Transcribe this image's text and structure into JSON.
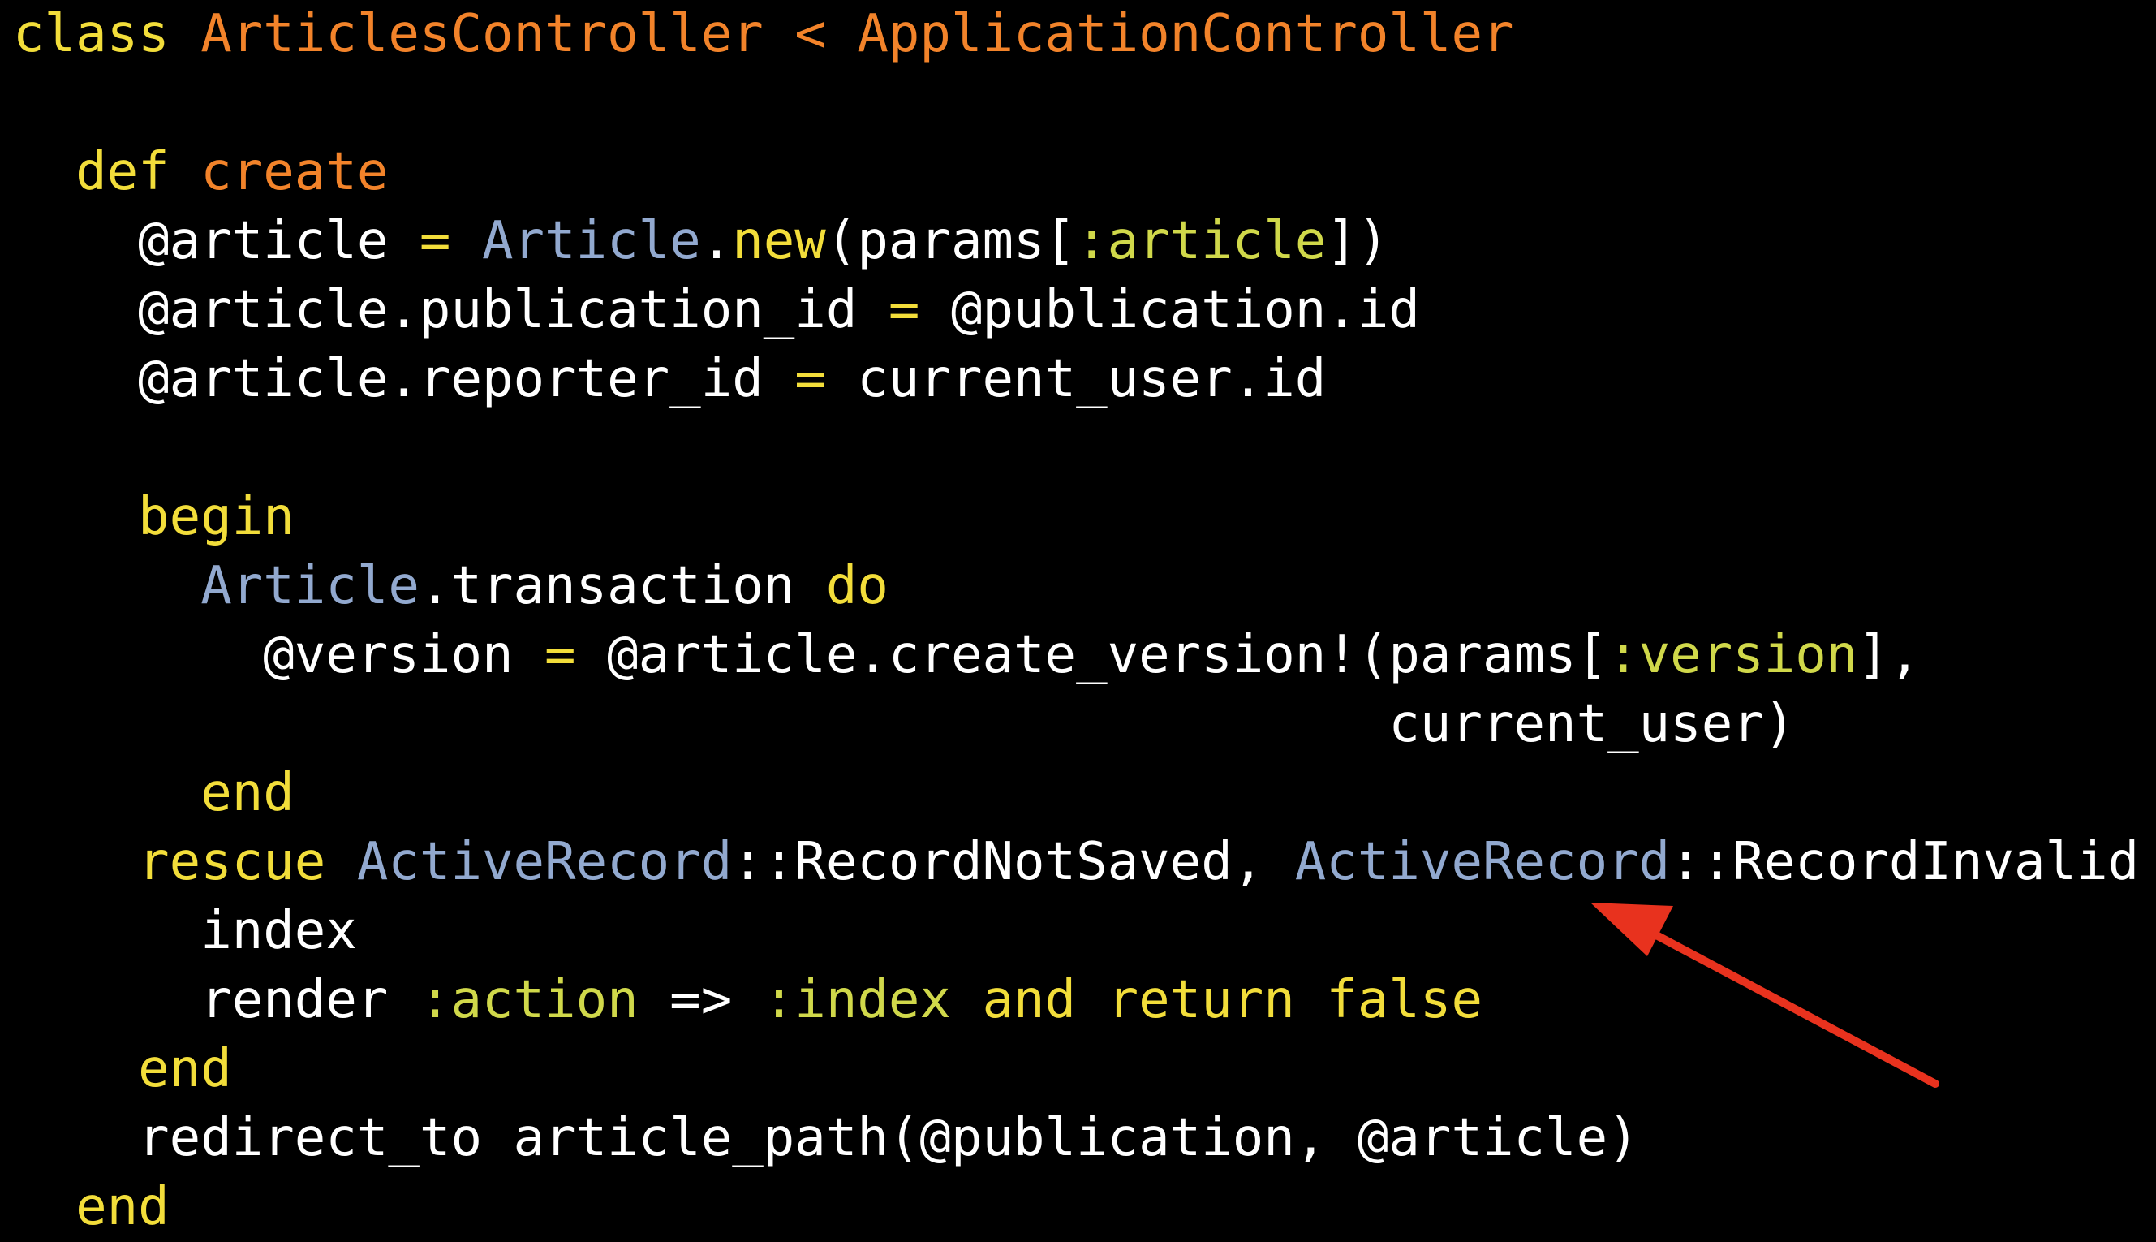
{
  "code": {
    "lines": [
      [
        {
          "t": "class ",
          "c": "k"
        },
        {
          "t": "ArticlesController",
          "c": "o"
        },
        {
          "t": " < ",
          "c": "o"
        },
        {
          "t": "ApplicationController",
          "c": "o"
        }
      ],
      [],
      [
        {
          "t": "  ",
          "c": "p"
        },
        {
          "t": "def",
          "c": "k"
        },
        {
          "t": " ",
          "c": "p"
        },
        {
          "t": "create",
          "c": "o"
        }
      ],
      [
        {
          "t": "    @article ",
          "c": "p"
        },
        {
          "t": "=",
          "c": "k"
        },
        {
          "t": " ",
          "c": "p"
        },
        {
          "t": "Article",
          "c": "c"
        },
        {
          "t": ".",
          "c": "p"
        },
        {
          "t": "new",
          "c": "k"
        },
        {
          "t": "(params[",
          "c": "p"
        },
        {
          "t": ":article",
          "c": "s"
        },
        {
          "t": "])",
          "c": "p"
        }
      ],
      [
        {
          "t": "    @article.publication_id ",
          "c": "p"
        },
        {
          "t": "=",
          "c": "k"
        },
        {
          "t": " @publication.id",
          "c": "p"
        }
      ],
      [
        {
          "t": "    @article.reporter_id ",
          "c": "p"
        },
        {
          "t": "=",
          "c": "k"
        },
        {
          "t": " current_user.id",
          "c": "p"
        }
      ],
      [],
      [
        {
          "t": "    ",
          "c": "p"
        },
        {
          "t": "begin",
          "c": "k"
        }
      ],
      [
        {
          "t": "      ",
          "c": "p"
        },
        {
          "t": "Article",
          "c": "c"
        },
        {
          "t": ".transaction ",
          "c": "p"
        },
        {
          "t": "do",
          "c": "k"
        }
      ],
      [
        {
          "t": "        @version ",
          "c": "p"
        },
        {
          "t": "=",
          "c": "k"
        },
        {
          "t": " @article.create_version!(params[",
          "c": "p"
        },
        {
          "t": ":version",
          "c": "s"
        },
        {
          "t": "],",
          "c": "p"
        }
      ],
      [
        {
          "t": "                                            current_user)",
          "c": "p"
        }
      ],
      [
        {
          "t": "      ",
          "c": "p"
        },
        {
          "t": "end",
          "c": "k"
        }
      ],
      [
        {
          "t": "    ",
          "c": "p"
        },
        {
          "t": "rescue",
          "c": "k"
        },
        {
          "t": " ",
          "c": "p"
        },
        {
          "t": "ActiveRecord",
          "c": "c"
        },
        {
          "t": "::RecordNotSaved, ",
          "c": "p"
        },
        {
          "t": "ActiveRecord",
          "c": "c"
        },
        {
          "t": "::RecordInvalid",
          "c": "p"
        }
      ],
      [
        {
          "t": "      index",
          "c": "p"
        }
      ],
      [
        {
          "t": "      render ",
          "c": "p"
        },
        {
          "t": ":action",
          "c": "s"
        },
        {
          "t": " => ",
          "c": "p"
        },
        {
          "t": ":index",
          "c": "s"
        },
        {
          "t": " ",
          "c": "p"
        },
        {
          "t": "and",
          "c": "k"
        },
        {
          "t": " ",
          "c": "p"
        },
        {
          "t": "return",
          "c": "k"
        },
        {
          "t": " ",
          "c": "p"
        },
        {
          "t": "false",
          "c": "k"
        }
      ],
      [
        {
          "t": "    ",
          "c": "p"
        },
        {
          "t": "end",
          "c": "k"
        }
      ],
      [
        {
          "t": "    redirect_to article_path(@publication, @article)",
          "c": "p"
        }
      ],
      [
        {
          "t": "  ",
          "c": "p"
        },
        {
          "t": "end",
          "c": "k"
        }
      ]
    ]
  },
  "colors": {
    "background": "#000000",
    "keyword": "#f2dd3a",
    "name": "#f2832a",
    "constant": "#92a9cf",
    "symbol": "#d0d84a",
    "plain": "#ffffff",
    "arrow": "#e8321e"
  },
  "annotation": {
    "icon": "arrow-icon",
    "points_to": "ActiveRecord"
  }
}
